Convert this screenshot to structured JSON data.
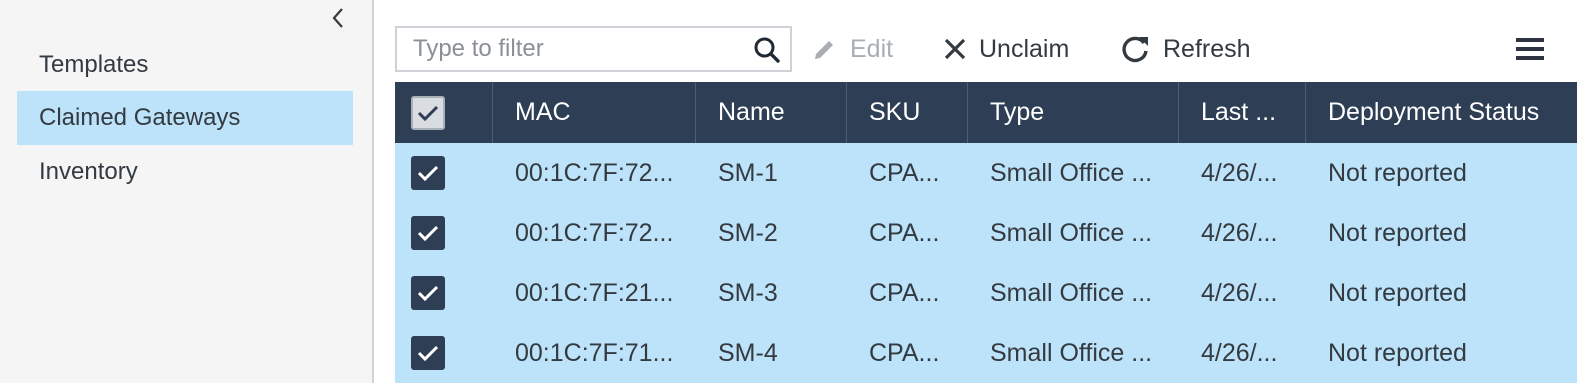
{
  "sidebar": {
    "items": [
      {
        "label": "Templates",
        "active": false
      },
      {
        "label": "Claimed Gateways",
        "active": true
      },
      {
        "label": "Inventory",
        "active": false
      }
    ]
  },
  "toolbar": {
    "filter_placeholder": "Type to filter",
    "filter_value": "",
    "edit_label": "Edit",
    "edit_enabled": false,
    "unclaim_label": "Unclaim",
    "refresh_label": "Refresh"
  },
  "grid": {
    "columns": [
      "MAC",
      "Name",
      "SKU",
      "Type",
      "Last ...",
      "Deployment Status"
    ],
    "header_checked": true,
    "rows": [
      {
        "checked": true,
        "mac": "00:1C:7F:72...",
        "name": "SM-1",
        "sku": "CPA...",
        "type": "Small Office ...",
        "last": "4/26/...",
        "status": "Not reported"
      },
      {
        "checked": true,
        "mac": "00:1C:7F:72...",
        "name": "SM-2",
        "sku": "CPA...",
        "type": "Small Office ...",
        "last": "4/26/...",
        "status": "Not reported"
      },
      {
        "checked": true,
        "mac": "00:1C:7F:21...",
        "name": "SM-3",
        "sku": "CPA...",
        "type": "Small Office ...",
        "last": "4/26/...",
        "status": "Not reported"
      },
      {
        "checked": true,
        "mac": "00:1C:7F:71...",
        "name": "SM-4",
        "sku": "CPA...",
        "type": "Small Office ...",
        "last": "4/26/...",
        "status": "Not reported"
      }
    ]
  },
  "colors": {
    "header_bg": "#2d3e55",
    "selected_row_bg": "#bde3fa",
    "sidebar_bg": "#f5f5f5"
  }
}
